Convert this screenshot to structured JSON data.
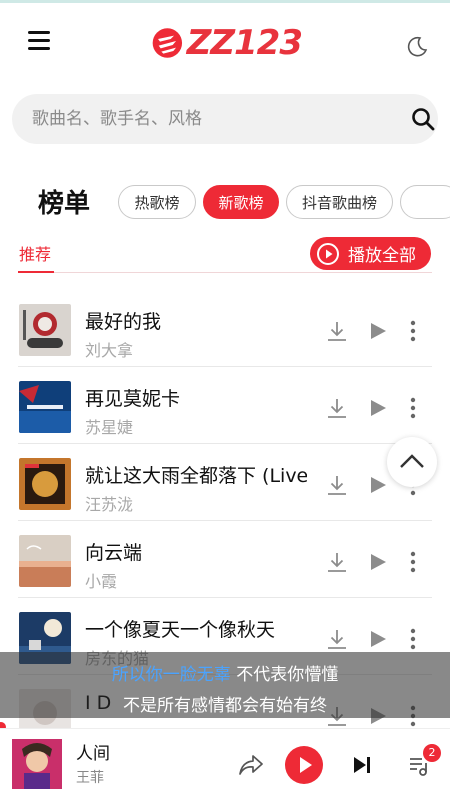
{
  "app": {
    "logo_text": "ZZ123",
    "accent": "#ee2a36"
  },
  "search": {
    "placeholder": "歌曲名、歌手名、风格"
  },
  "chart": {
    "title": "榜单",
    "tabs": [
      {
        "label": "热歌榜",
        "active": false
      },
      {
        "label": "新歌榜",
        "active": true
      },
      {
        "label": "抖音歌曲榜",
        "active": false
      }
    ]
  },
  "subtab": {
    "label": "推荐"
  },
  "play_all": {
    "label": "播放全部"
  },
  "songs": [
    {
      "title": "最好的我",
      "artist": "刘大拿"
    },
    {
      "title": "再见莫妮卡",
      "artist": "苏星婕"
    },
    {
      "title": "就让这大雨全都落下 (Live",
      "artist": "汪苏泷"
    },
    {
      "title": "向云端",
      "artist": "小霞"
    },
    {
      "title": "一个像夏天一个像秋天",
      "artist": "房东的猫"
    },
    {
      "title": "I D",
      "artist": ""
    }
  ],
  "lyrics": {
    "line1_part1": "所以你一脸无辜",
    "line1_part2": "不代表你懵懂",
    "line2": "不是所有感情都会有始有终"
  },
  "player": {
    "title": "人间",
    "artist": "王菲",
    "queue_count": "2"
  }
}
